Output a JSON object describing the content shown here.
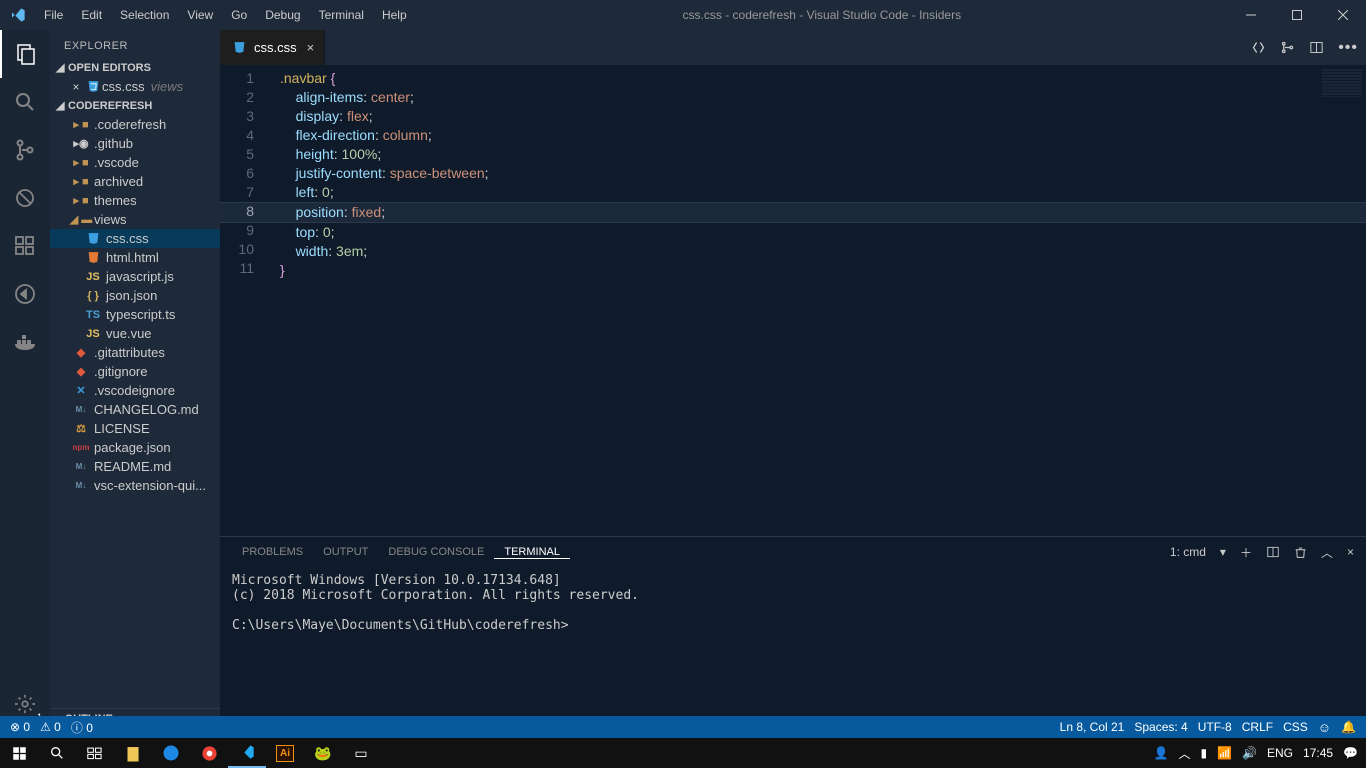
{
  "window": {
    "title": "css.css - coderefresh - Visual Studio Code - Insiders"
  },
  "menu": [
    "File",
    "Edit",
    "Selection",
    "View",
    "Go",
    "Debug",
    "Terminal",
    "Help"
  ],
  "sidebar": {
    "title": "EXPLORER",
    "open_editors": {
      "header": "OPEN EDITORS",
      "items": [
        {
          "name": "css.css",
          "group": "views"
        }
      ]
    },
    "folder": {
      "header": "CODEREFRESH",
      "tree": [
        {
          "type": "folder",
          "name": ".coderefresh",
          "icon": "folder"
        },
        {
          "type": "folder",
          "name": ".github",
          "icon": "github"
        },
        {
          "type": "folder",
          "name": ".vscode",
          "icon": "folder"
        },
        {
          "type": "folder",
          "name": "archived",
          "icon": "folder"
        },
        {
          "type": "folder",
          "name": "themes",
          "icon": "folder"
        },
        {
          "type": "folder",
          "name": "views",
          "icon": "folder-open",
          "expanded": true,
          "children": [
            {
              "type": "file",
              "name": "css.css",
              "icon": "css3",
              "selected": true
            },
            {
              "type": "file",
              "name": "html.html",
              "icon": "html5"
            },
            {
              "type": "file",
              "name": "javascript.js",
              "icon": "js"
            },
            {
              "type": "file",
              "name": "json.json",
              "icon": "json"
            },
            {
              "type": "file",
              "name": "typescript.ts",
              "icon": "ts"
            },
            {
              "type": "file",
              "name": "vue.vue",
              "icon": "js"
            }
          ]
        },
        {
          "type": "file",
          "name": ".gitattributes",
          "icon": "git"
        },
        {
          "type": "file",
          "name": ".gitignore",
          "icon": "git"
        },
        {
          "type": "file",
          "name": ".vscodeignore",
          "icon": "vs"
        },
        {
          "type": "file",
          "name": "CHANGELOG.md",
          "icon": "md"
        },
        {
          "type": "file",
          "name": "LICENSE",
          "icon": "lic"
        },
        {
          "type": "file",
          "name": "package.json",
          "icon": "npm"
        },
        {
          "type": "file",
          "name": "README.md",
          "icon": "md"
        },
        {
          "type": "file",
          "name": "vsc-extension-qui...",
          "icon": "md"
        }
      ]
    },
    "outline": {
      "header": "OUTLINE"
    }
  },
  "tabs": [
    {
      "name": "css.css",
      "icon": "css3"
    }
  ],
  "editor": {
    "lines": [
      {
        "n": 1,
        "tokens": [
          [
            "sel",
            ".navbar"
          ],
          [
            "punct",
            " "
          ],
          [
            "brace",
            "{"
          ]
        ]
      },
      {
        "n": 2,
        "tokens": [
          [
            "punct",
            "    "
          ],
          [
            "prop",
            "align-items"
          ],
          [
            "punct",
            ": "
          ],
          [
            "val",
            "center"
          ],
          [
            "punct",
            ";"
          ]
        ]
      },
      {
        "n": 3,
        "tokens": [
          [
            "punct",
            "    "
          ],
          [
            "prop",
            "display"
          ],
          [
            "punct",
            ": "
          ],
          [
            "val",
            "flex"
          ],
          [
            "punct",
            ";"
          ]
        ]
      },
      {
        "n": 4,
        "tokens": [
          [
            "punct",
            "    "
          ],
          [
            "prop",
            "flex-direction"
          ],
          [
            "punct",
            ": "
          ],
          [
            "val",
            "column"
          ],
          [
            "punct",
            ";"
          ]
        ]
      },
      {
        "n": 5,
        "tokens": [
          [
            "punct",
            "    "
          ],
          [
            "prop",
            "height"
          ],
          [
            "punct",
            ": "
          ],
          [
            "num",
            "100%"
          ],
          [
            "punct",
            ";"
          ]
        ]
      },
      {
        "n": 6,
        "tokens": [
          [
            "punct",
            "    "
          ],
          [
            "prop",
            "justify-content"
          ],
          [
            "punct",
            ": "
          ],
          [
            "val",
            "space-between"
          ],
          [
            "punct",
            ";"
          ]
        ]
      },
      {
        "n": 7,
        "tokens": [
          [
            "punct",
            "    "
          ],
          [
            "prop",
            "left"
          ],
          [
            "punct",
            ": "
          ],
          [
            "num",
            "0"
          ],
          [
            "punct",
            ";"
          ]
        ]
      },
      {
        "n": 8,
        "tokens": [
          [
            "punct",
            "    "
          ],
          [
            "prop",
            "position"
          ],
          [
            "punct",
            ": "
          ],
          [
            "val",
            "fixed"
          ],
          [
            "punct",
            ";"
          ]
        ],
        "current": true
      },
      {
        "n": 9,
        "tokens": [
          [
            "punct",
            "    "
          ],
          [
            "prop",
            "top"
          ],
          [
            "punct",
            ": "
          ],
          [
            "num",
            "0"
          ],
          [
            "punct",
            ";"
          ]
        ]
      },
      {
        "n": 10,
        "tokens": [
          [
            "punct",
            "    "
          ],
          [
            "prop",
            "width"
          ],
          [
            "punct",
            ": "
          ],
          [
            "num",
            "3em"
          ],
          [
            "punct",
            ";"
          ]
        ]
      },
      {
        "n": 11,
        "tokens": [
          [
            "brace",
            "}"
          ]
        ]
      }
    ]
  },
  "panel": {
    "tabs": [
      "PROBLEMS",
      "OUTPUT",
      "DEBUG CONSOLE",
      "TERMINAL"
    ],
    "active_tab": "TERMINAL",
    "terminal_selector": "1: cmd",
    "terminal_lines": [
      "Microsoft Windows [Version 10.0.17134.648]",
      "(c) 2018 Microsoft Corporation. All rights reserved.",
      "",
      "C:\\Users\\Maye\\Documents\\GitHub\\coderefresh>"
    ]
  },
  "status": {
    "errors": "0",
    "warnings": "0",
    "info": "0",
    "ln_col": "Ln 8, Col 21",
    "spaces": "Spaces: 4",
    "encoding": "UTF-8",
    "eol": "CRLF",
    "lang": "CSS"
  },
  "taskbar": {
    "lang": "ENG",
    "time": "17:45"
  }
}
